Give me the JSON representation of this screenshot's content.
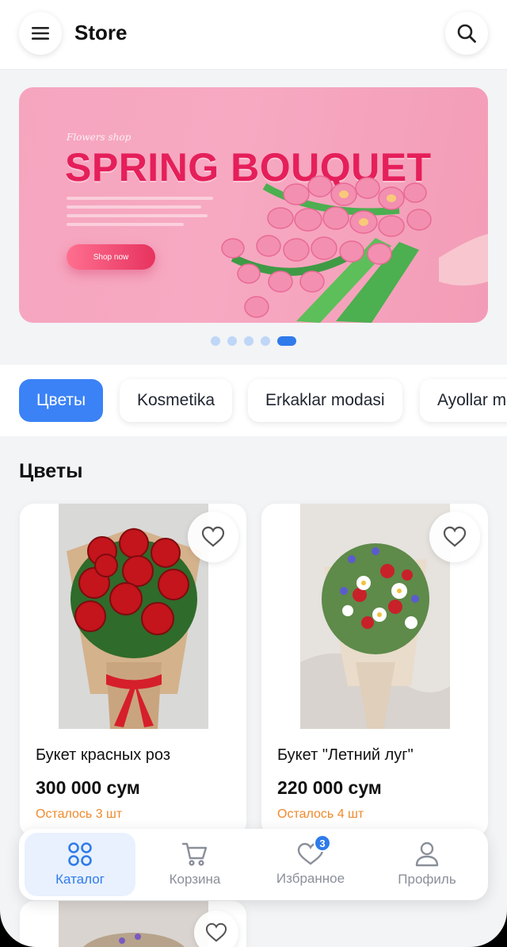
{
  "header": {
    "title": "Store",
    "menu_icon": "menu-icon",
    "search_icon": "search-icon"
  },
  "banner": {
    "small_text": "Flowers shop",
    "headline": "SPRING BOUQUET",
    "button_label": "Shop now",
    "slides_total": 5,
    "active_slide": 5
  },
  "categories": [
    {
      "label": "Цветы",
      "active": true
    },
    {
      "label": "Kosmetika",
      "active": false
    },
    {
      "label": "Erkaklar modasi",
      "active": false
    },
    {
      "label": "Ayollar modasi",
      "active": false
    }
  ],
  "section_title": "Цветы",
  "products": [
    {
      "name": "Букет красных роз",
      "price": "300 000 сум",
      "stock": "Осталось 3 шт"
    },
    {
      "name": "Букет \"Летний луг\"",
      "price": "220 000 сум",
      "stock": "Осталось 4 шт"
    }
  ],
  "bottom_nav": {
    "items": [
      {
        "label": "Каталог",
        "icon": "grid-icon",
        "active": true
      },
      {
        "label": "Корзина",
        "icon": "cart-icon",
        "active": false
      },
      {
        "label": "Избранное",
        "icon": "heart-icon",
        "active": false,
        "badge": "3"
      },
      {
        "label": "Профиль",
        "icon": "user-icon",
        "active": false
      }
    ]
  },
  "colors": {
    "accent": "#3b82f6",
    "stock": "#f08a2c",
    "banner": "#f7a9c2",
    "banner_headline": "#e51f5a"
  }
}
